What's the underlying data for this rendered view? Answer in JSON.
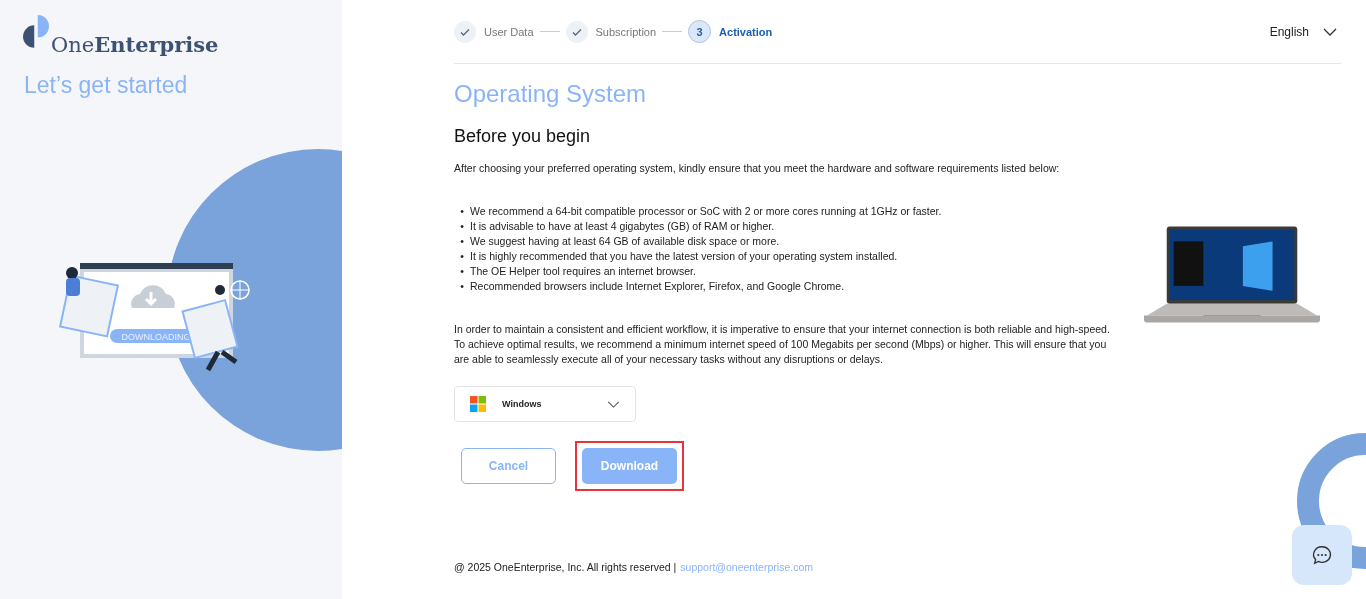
{
  "brand": {
    "name_light": "One",
    "name_bold": "Enterprise",
    "tagline": "Let’s get started"
  },
  "illustration": {
    "label": "DOWNLOADING"
  },
  "steps": [
    {
      "label": "User Data",
      "completed": true,
      "selected": false
    },
    {
      "label": "Subscription",
      "completed": true,
      "selected": false
    },
    {
      "number": "3",
      "label": "Activation",
      "completed": false,
      "selected": true
    }
  ],
  "language": "English",
  "title": "Operating System",
  "subtitle": "Before you begin",
  "intro": "After choosing your preferred operating system, kindly ensure that you meet the hardware and software requirements listed below:",
  "requirements": [
    {
      "bullet": "•",
      "text": "We recommend a 64-bit compatible processor or SoC with 2 or more cores running at 1GHz or faster."
    },
    {
      "bullet": "•",
      "text": "It is advisable to have at least 4 gigabytes (GB) of RAM or higher."
    },
    {
      "bullet": "•",
      "text": "We suggest having at least 64 GB of available disk space or more."
    },
    {
      "bullet": "•",
      "text": "It is highly recommended that you have the latest version of your operating system installed."
    },
    {
      "bullet": "•",
      "text": "The OE Helper tool requires an internet browser."
    },
    {
      "bullet": "•",
      "text": "Recommended browsers include Internet Explorer, Firefox, and Google Chrome."
    }
  ],
  "note": "In order to maintain a consistent and efficient workflow, it is imperative to ensure that your internet connection is both reliable and high-speed. To achieve optimal results, we recommend a minimum internet speed of 100 Megabits per second (Mbps) or higher. This will ensure that you are able to seamlessly execute all of your necessary tasks without any disruptions or delays.",
  "os_select": {
    "value": "Windows"
  },
  "buttons": [
    {
      "label": "Cancel",
      "kind": "outline",
      "highlighted": false
    },
    {
      "label": "Download",
      "kind": "primary",
      "highlighted": true
    }
  ],
  "footer": {
    "copyright": "@ 2025 OneEnterprise, Inc. All rights reserved |",
    "email": "support@oneenterprise.com"
  }
}
